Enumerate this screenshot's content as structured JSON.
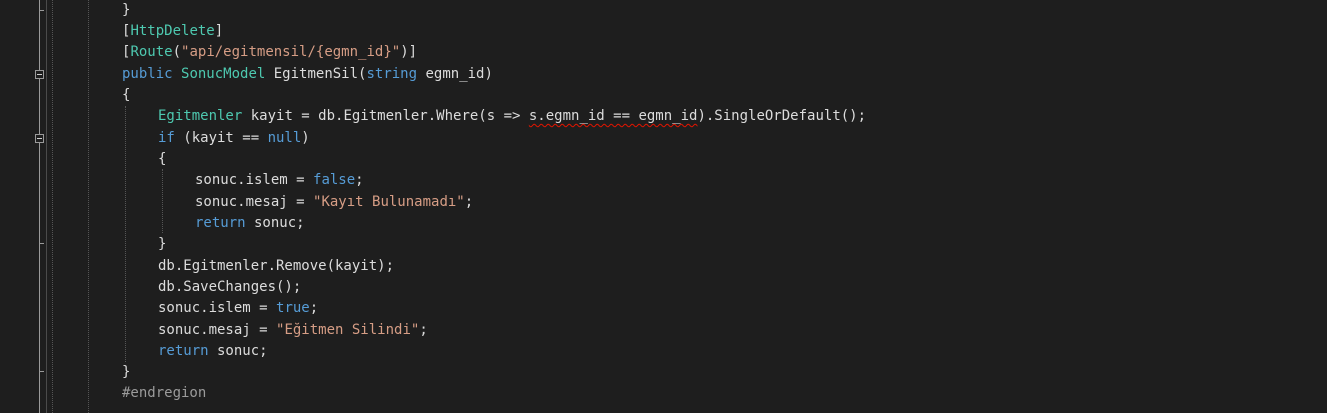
{
  "editor": {
    "colors": {
      "background": "#1e1e1e",
      "default_text": "#dcdcdc",
      "keyword": "#569cd6",
      "type": "#4ec9b0",
      "string": "#d69d85",
      "preprocessor": "#9b9b9b",
      "error_squiggle": "#e51400"
    },
    "fold_icons": [
      "collapse-icon",
      "collapse-icon"
    ],
    "lines": {
      "l01": {
        "t1": "}"
      },
      "l02": {
        "t1": "[",
        "t2": "HttpDelete",
        "t3": "]"
      },
      "l03": {
        "t1": "[",
        "t2": "Route",
        "t3": "(",
        "t4": "\"api/egitmensil/{egmn_id}\"",
        "t5": ")]"
      },
      "l04": {
        "t1": "public",
        "t2": " ",
        "t3": "SonucModel",
        "t4": " EgitmenSil(",
        "t5": "string",
        "t6": " egmn_id)"
      },
      "l05": {
        "t1": "{"
      },
      "l06": {
        "t1": "Egitmenler",
        "t2": " kayit = db.Egitmenler.Where(s => ",
        "t3": "s.egmn_id == egmn_id",
        "t4": ").SingleOrDefault();"
      },
      "l07": {
        "t1": "if",
        "t2": " (kayit == ",
        "t3": "null",
        "t4": ")"
      },
      "l08": {
        "t1": "{"
      },
      "l09": {
        "t1": "sonuc.islem = ",
        "t2": "false",
        "t3": ";"
      },
      "l10": {
        "t1": "sonuc.mesaj = ",
        "t2": "\"Kayıt Bulunamadı\"",
        "t3": ";"
      },
      "l11": {
        "t1": "return",
        "t2": " sonuc;"
      },
      "l12": {
        "t1": "}"
      },
      "l13": {
        "t1": "db.Egitmenler.Remove(kayit);"
      },
      "l14": {
        "t1": "db.SaveChanges();"
      },
      "l15": {
        "t1": "sonuc.islem = ",
        "t2": "true",
        "t3": ";"
      },
      "l16": {
        "t1": "sonuc.mesaj = ",
        "t2": "\"Eğitmen Silindi\"",
        "t3": ";"
      },
      "l17": {
        "t1": "return",
        "t2": " sonuc;"
      },
      "l18": {
        "t1": "}"
      },
      "l19": {
        "t1": "#endregion"
      }
    }
  }
}
